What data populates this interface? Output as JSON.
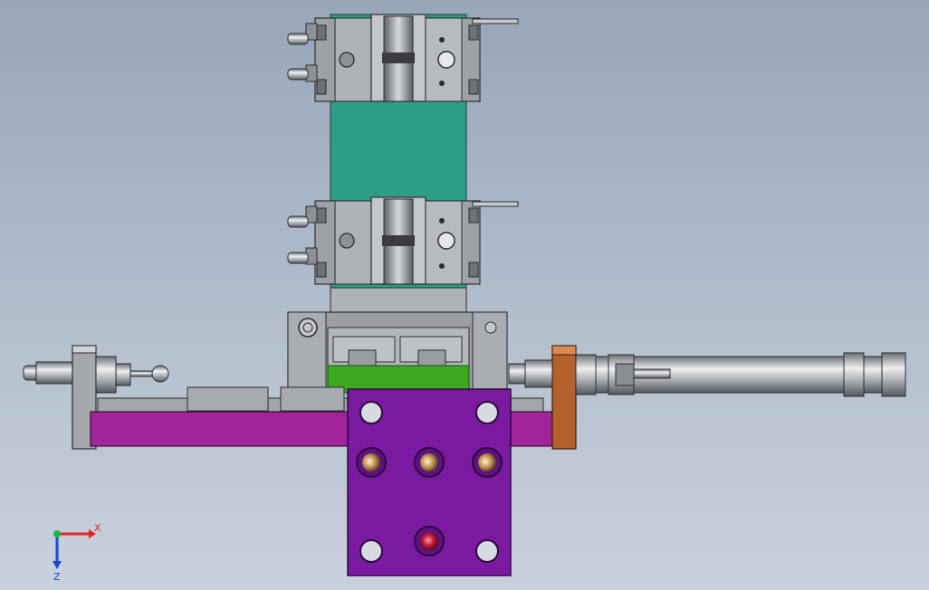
{
  "viewport": {
    "background_top": "#97a6b8",
    "background_bottom": "#c9d1dc"
  },
  "parts": {
    "vertical_block_color": "#2e9e87",
    "base_plate_color": "#7a1aa0",
    "slide_rail_color": "#a0259a",
    "green_block_color": "#3da922",
    "copper_stop_color": "#b4622c",
    "steel_color": "#b9bcc1"
  },
  "triad": {
    "x_label": "X",
    "z_label": "Z",
    "x_color": "#e0262b",
    "y_color": "#1db84a",
    "z_color": "#1f47d6"
  }
}
